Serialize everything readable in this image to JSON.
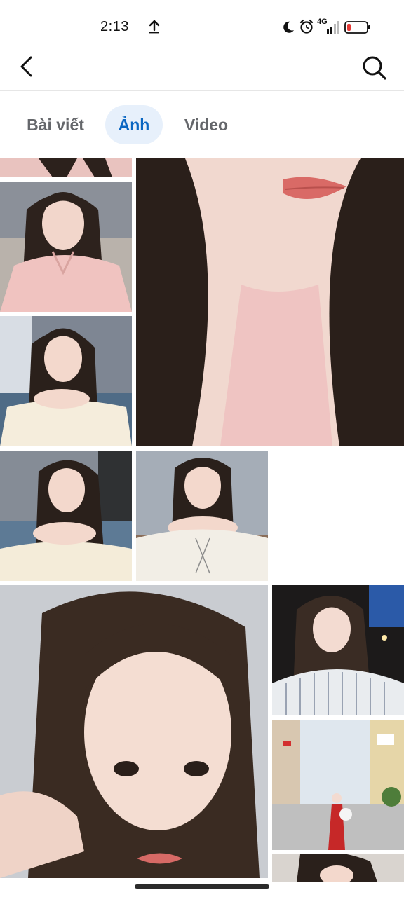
{
  "status_bar": {
    "time": "2:13",
    "network": "4G",
    "battery_color": "#e53935"
  },
  "header": {
    "back_icon": "chevron-left-icon",
    "search_icon": "search-icon"
  },
  "tabs": [
    {
      "label": "Bài viết",
      "selected": false
    },
    {
      "label": "Ảnh",
      "selected": true
    },
    {
      "label": "Video",
      "selected": false
    }
  ],
  "photos": [
    {
      "name": "photo-pink-top-strip"
    },
    {
      "name": "photo-pink-pajama-selfie"
    },
    {
      "name": "photo-closeup-lips"
    },
    {
      "name": "photo-offshoulder-blue-sofa"
    },
    {
      "name": "photo-offshoulder-sofa-2"
    },
    {
      "name": "photo-offshoulder-white-blouse"
    },
    {
      "name": "photo-face-closeup-large"
    },
    {
      "name": "photo-striped-shirt-night"
    },
    {
      "name": "photo-street-red-dress"
    },
    {
      "name": "photo-bottom-partial"
    }
  ],
  "accent_color": "#0a66c2"
}
